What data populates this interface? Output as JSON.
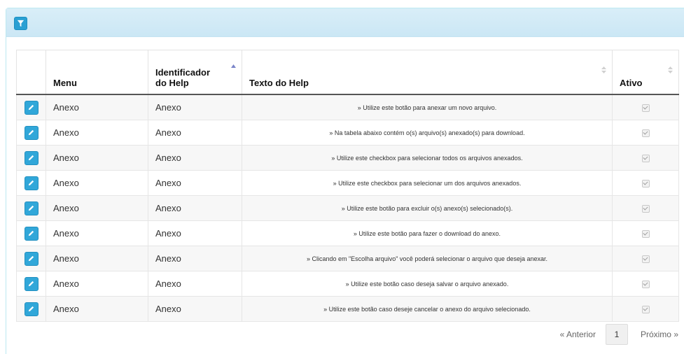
{
  "table": {
    "columns": {
      "menu": "Menu",
      "identificador": "Identificador do Help",
      "texto": "Texto do Help",
      "ativo": "Ativo"
    },
    "rows": [
      {
        "menu": "Anexo",
        "identificador": "Anexo",
        "texto": "» Utilize este botão para anexar um novo arquivo.",
        "ativo": true
      },
      {
        "menu": "Anexo",
        "identificador": "Anexo",
        "texto": "» Na tabela abaixo contém o(s) arquivo(s) anexado(s) para download.",
        "ativo": true
      },
      {
        "menu": "Anexo",
        "identificador": "Anexo",
        "texto": "» Utilize este checkbox para selecionar todos os arquivos anexados.",
        "ativo": true
      },
      {
        "menu": "Anexo",
        "identificador": "Anexo",
        "texto": "» Utilize este checkbox para selecionar um dos arquivos anexados.",
        "ativo": true
      },
      {
        "menu": "Anexo",
        "identificador": "Anexo",
        "texto": "» Utilize este botão para excluir o(s) anexo(s) selecionado(s).",
        "ativo": true
      },
      {
        "menu": "Anexo",
        "identificador": "Anexo",
        "texto": "» Utilize este botão para fazer o download do anexo.",
        "ativo": true
      },
      {
        "menu": "Anexo",
        "identificador": "Anexo",
        "texto": "» Clicando em \"Escolha arquivo\" você poderá selecionar o arquivo que deseja anexar.",
        "ativo": true
      },
      {
        "menu": "Anexo",
        "identificador": "Anexo",
        "texto": "» Utilize este botão caso deseja salvar o arquivo anexado.",
        "ativo": true
      },
      {
        "menu": "Anexo",
        "identificador": "Anexo",
        "texto": "» Utilize este botão caso deseje cancelar o anexo do arquivo selecionado.",
        "ativo": true
      }
    ]
  },
  "pagination": {
    "prev_label": "« Anterior",
    "current_page": "1",
    "next_label": "Próximo »"
  },
  "icons": {
    "filter": "filter-icon",
    "edit": "pencil-icon",
    "sort": "sort-icon"
  },
  "colors": {
    "accent": "#2aa0d3",
    "heading_bg": "#d9eef8"
  }
}
